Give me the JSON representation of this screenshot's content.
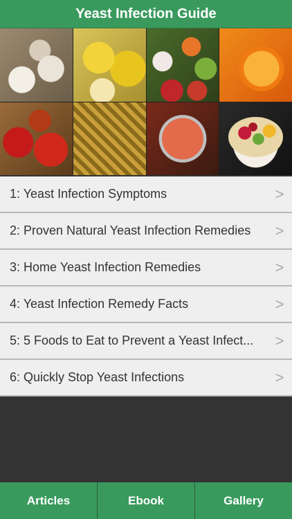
{
  "header": {
    "title": "Yeast Infection Guide"
  },
  "banner": {
    "tiles": [
      {
        "name": "garlic-image"
      },
      {
        "name": "lemons-image"
      },
      {
        "name": "yogurt-fruit-image"
      },
      {
        "name": "orange-image"
      },
      {
        "name": "apples-image"
      },
      {
        "name": "pineapples-image"
      },
      {
        "name": "grapefruit-image"
      },
      {
        "name": "fruit-salad-image"
      }
    ]
  },
  "list": {
    "items": [
      {
        "label": "1: Yeast Infection Symptoms",
        "chevron": ">"
      },
      {
        "label": "2: Proven Natural Yeast Infection Remedies",
        "chevron": ">"
      },
      {
        "label": "3: Home Yeast Infection Remedies",
        "chevron": ">"
      },
      {
        "label": "4: Yeast Infection Remedy Facts",
        "chevron": ">"
      },
      {
        "label": "5: 5 Foods to Eat to Prevent a Yeast Infect...",
        "chevron": ">"
      },
      {
        "label": "6: Quickly Stop Yeast Infections",
        "chevron": ">"
      }
    ]
  },
  "tabs": [
    {
      "label": "Articles"
    },
    {
      "label": "Ebook"
    },
    {
      "label": "Gallery"
    }
  ],
  "colors": {
    "accent": "#3a9a5e",
    "list_bg": "#efefef",
    "page_bg": "#333333"
  }
}
